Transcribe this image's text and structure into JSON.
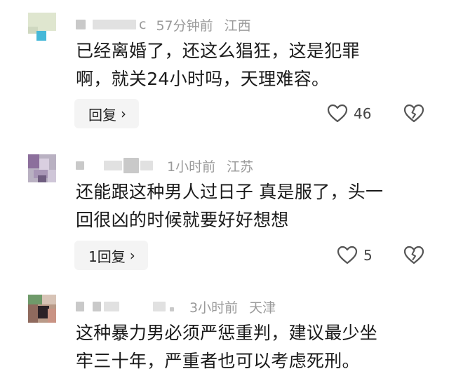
{
  "comments": [
    {
      "meta_blur_suffix": "c",
      "time": "57分钟前",
      "location": "江西",
      "line1": "已经离婚了，还这么猖狂，这是犯罪",
      "line2": "啊，就关24小时吗，天理难容。",
      "reply_label": "回复",
      "like_count": "46"
    },
    {
      "meta_blur_suffix": "",
      "time": "1小时前",
      "location": "江苏",
      "line1": "还能跟这种男人过日子 真是服了，头一",
      "line2": "回很凶的时候就要好好想想",
      "reply_label": "1回复",
      "like_count": "5"
    },
    {
      "meta_blur_suffix": "",
      "time": "3小时前",
      "location": "天津",
      "line1": "这种暴力男必须严惩重判，建议最少坐",
      "line2": "牢三十年，严重者也可以考虑死刑。",
      "reply_label": "",
      "like_count": ""
    }
  ],
  "icons": {
    "like": "heart-outline-icon",
    "dislike": "broken-heart-icon",
    "chevron": "chevron-right-icon"
  },
  "colors": {
    "meta_text": "#9a9a9a",
    "reply_bg": "#f4f4f4",
    "icon_stroke": "#555555"
  }
}
